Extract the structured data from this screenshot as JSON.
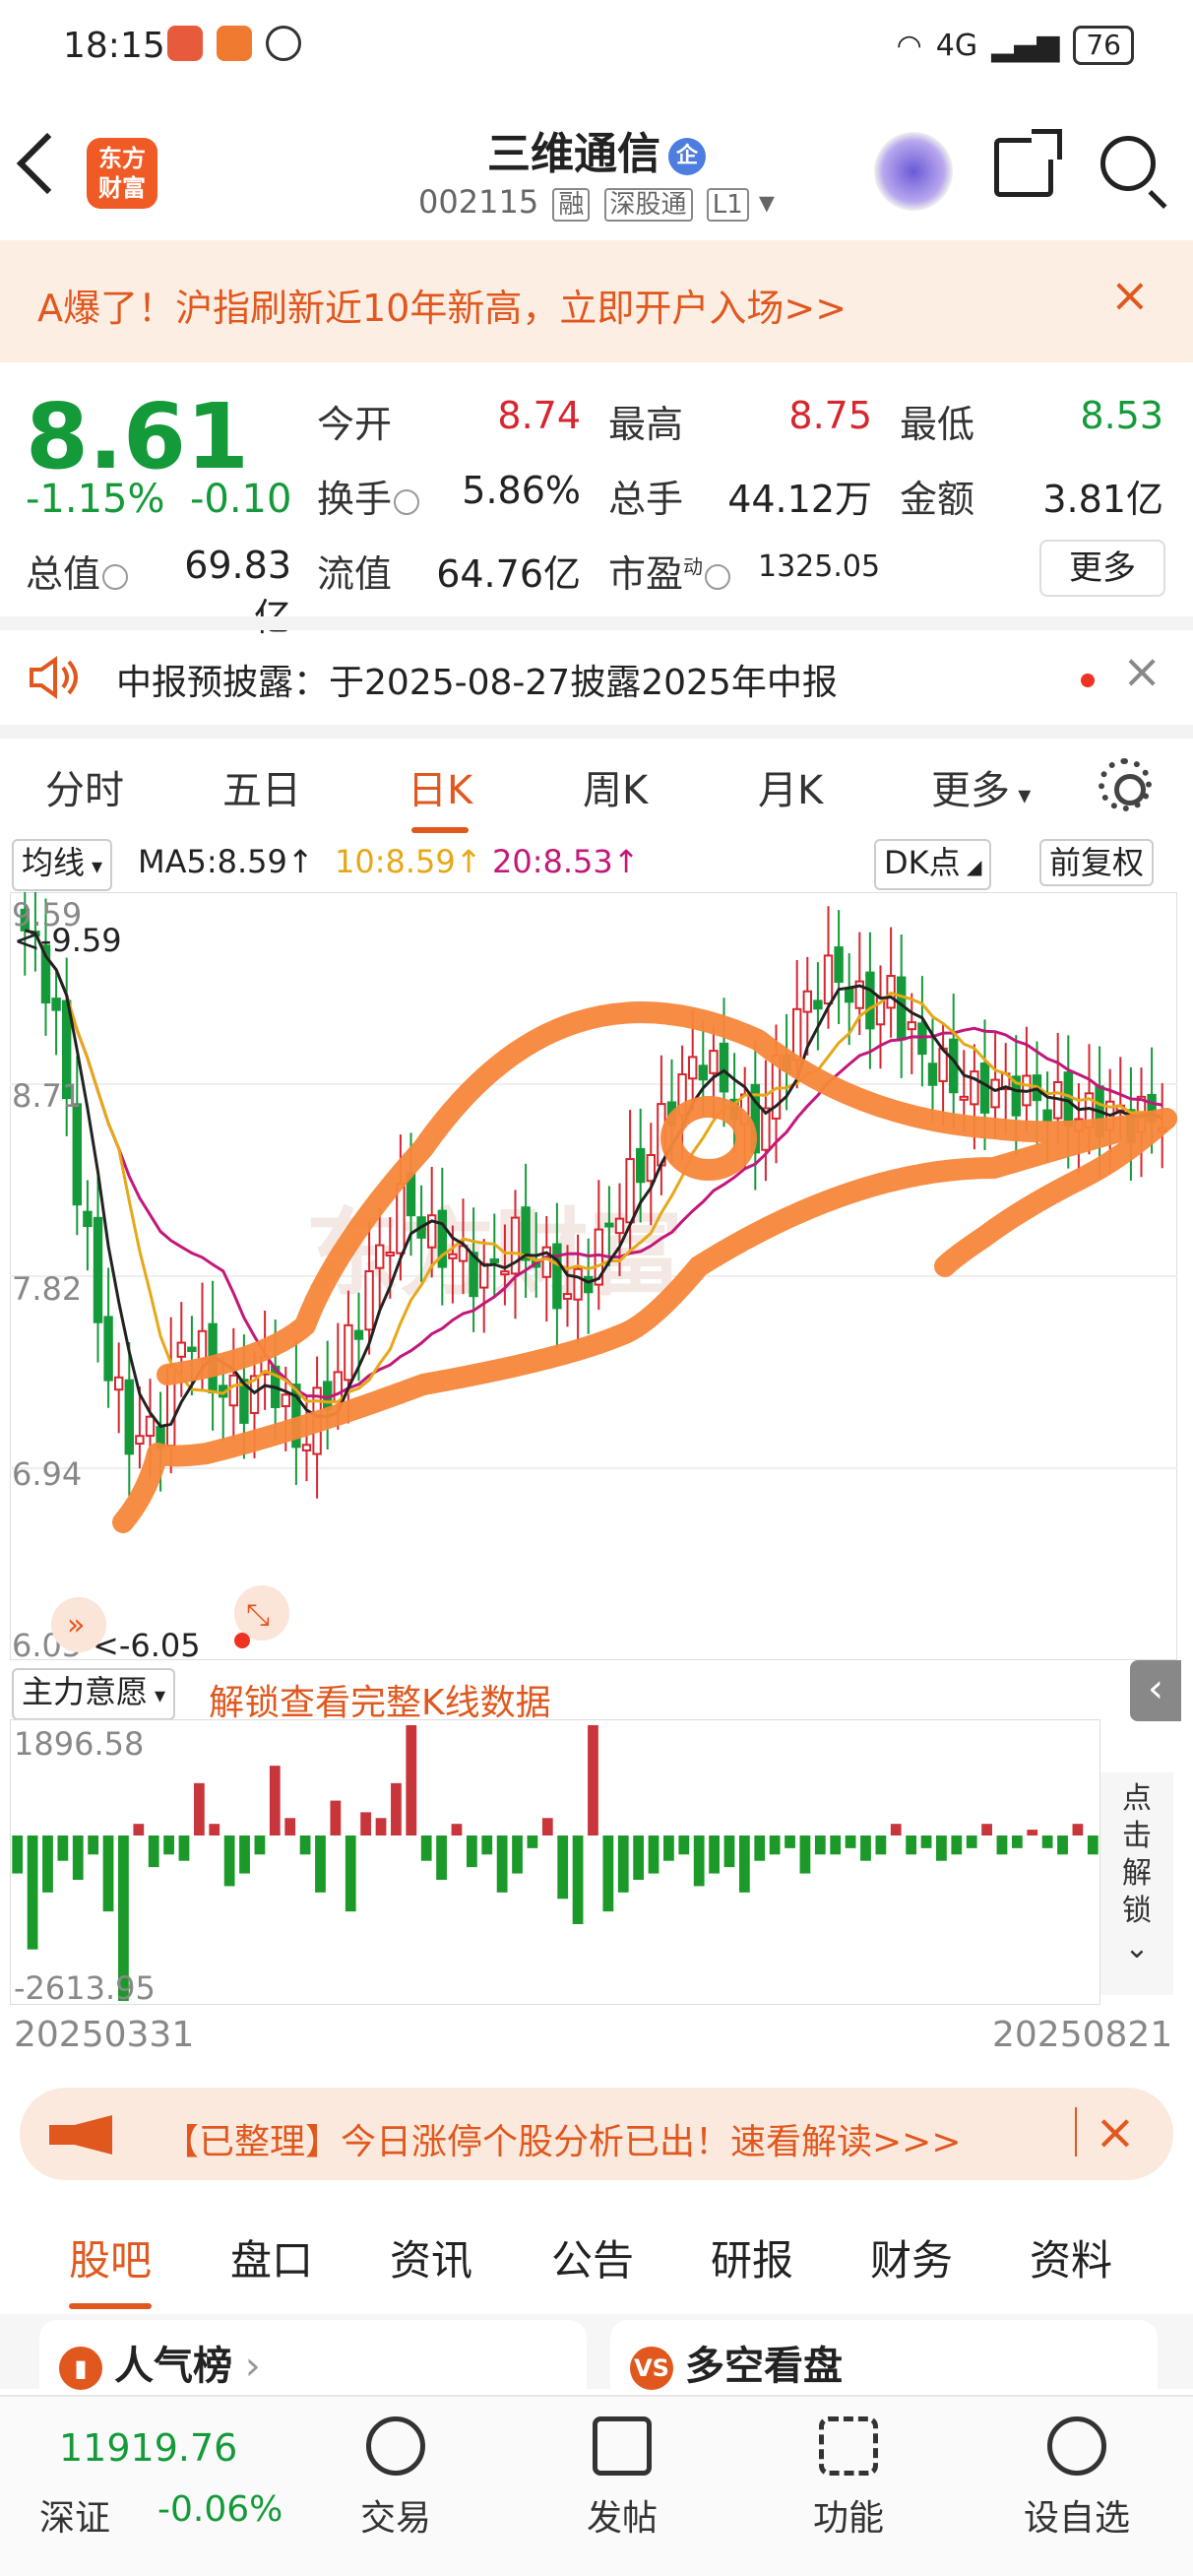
{
  "status_bar": {
    "time": "18:15",
    "battery": "76",
    "net": "4G"
  },
  "header": {
    "back_icon": "back-chevron-icon",
    "logo_text": [
      "东方",
      "财富"
    ],
    "title": "三维通信",
    "badge": "企",
    "code": "002115",
    "tags": [
      "融",
      "深股通",
      "L1"
    ]
  },
  "banner": {
    "text": "A爆了！沪指刷新近10年新高，立即开户入场>>",
    "close": "×"
  },
  "quote": {
    "price": "8.61",
    "change_pct": "-1.15%",
    "change": "-0.10",
    "open_label": "今开",
    "open": "8.74",
    "high_label": "最高",
    "high": "8.75",
    "low_label": "最低",
    "low": "8.53",
    "turnover_label": "换手",
    "turnover": "5.86%",
    "volume_label": "总手",
    "volume": "44.12万",
    "amount_label": "金额",
    "amount": "3.81亿",
    "mcap_label": "总值",
    "mcap": "69.83亿",
    "float_label": "流值",
    "float": "64.76亿",
    "pe_label": "市盈",
    "pe_sup": "动",
    "pe": "1325.05",
    "more": "更多"
  },
  "notice": {
    "text": "中报预披露：于2025-08-27披露2025年中报",
    "close": "×"
  },
  "kline_tabs": [
    "分时",
    "五日",
    "日K",
    "周K",
    "月K",
    "更多"
  ],
  "active_tab": "日K",
  "ma_row": {
    "selector": "均线",
    "ma5": "MA5:8.59↑",
    "ma10": "10:8.59↑",
    "ma20": "20:8.53↑",
    "dk": "DK点",
    "adjust": "前复权"
  },
  "price_axis": {
    "max": "9.59",
    "l2": "8.71",
    "l3": "7.82",
    "l4": "6.94",
    "min": "6.05",
    "high_mark": "<-9.59",
    "low_mark": "<-6.05"
  },
  "watermark": "东方财富",
  "indicator": {
    "selector": "主力意愿",
    "unlock_text": "解锁查看完整K线数据",
    "max": "1896.58",
    "min": "-2613.95",
    "date_start": "20250331",
    "date_end": "20250821",
    "side_unlock": [
      "点",
      "击",
      "解",
      "锁"
    ]
  },
  "ad": {
    "text": "【已整理】今日涨停个股分析已出！速看解读>>>",
    "close": "×"
  },
  "bottom_tabs": [
    "股吧",
    "盘口",
    "资讯",
    "公告",
    "研报",
    "财务",
    "资料"
  ],
  "cards": {
    "left": "人气榜",
    "right": "多空看盘"
  },
  "nav": {
    "index_value": "11919.76",
    "index_name": "深证",
    "index_change": "-0.06%",
    "items": [
      "交易",
      "发帖",
      "功能",
      "设自选"
    ]
  },
  "colors": {
    "up": "#d6262f",
    "down": "#159a3a",
    "accent": "#e0581e",
    "ma5": "#222222",
    "ma10": "#e6a817",
    "ma20": "#c2187a",
    "annotation": "#f7873a"
  },
  "chart_data": {
    "type": "candlestick",
    "price_range": [
      6.05,
      9.59
    ],
    "series": [
      {
        "name": "MA5",
        "value": 8.59
      },
      {
        "name": "MA10",
        "value": 8.59
      },
      {
        "name": "MA20",
        "value": 8.53
      }
    ],
    "close_path": [
      9.5,
      9.2,
      8.2,
      7.4,
      7.0,
      7.1,
      7.6,
      7.3,
      7.2,
      7.4,
      7.0,
      7.2,
      7.5,
      7.9,
      8.2,
      8.0,
      7.9,
      7.8,
      8.0,
      7.9,
      7.7,
      7.9,
      8.2,
      8.4,
      8.7,
      8.9,
      8.7,
      8.5,
      8.9,
      9.2,
      9.3,
      9.1,
      9.2,
      8.9,
      8.8,
      8.7,
      8.75,
      8.7,
      8.65,
      8.6,
      8.62,
      8.58,
      8.61
    ],
    "indicator_bars": [
      -600,
      -1800,
      -900,
      -400,
      -700,
      -300,
      -1200,
      -2613.95,
      200,
      -500,
      -300,
      -400,
      900,
      200,
      -800,
      -600,
      -300,
      1200,
      300,
      -300,
      -900,
      600,
      -1200,
      400,
      300,
      900,
      1896.58,
      -400,
      -700,
      200,
      -500,
      -300,
      -900,
      -600,
      -200,
      300,
      -1000,
      -1400,
      1896.58,
      -1200,
      -900,
      -700,
      -600,
      -400,
      -300,
      -800,
      -600,
      -500,
      -900,
      -400,
      -300,
      -200,
      -600,
      -300,
      -300,
      -200,
      -400,
      -300,
      200,
      -300,
      -200,
      -400,
      -300,
      -200,
      200,
      -300,
      -200,
      100,
      -200,
      -300,
      200,
      -300
    ]
  }
}
